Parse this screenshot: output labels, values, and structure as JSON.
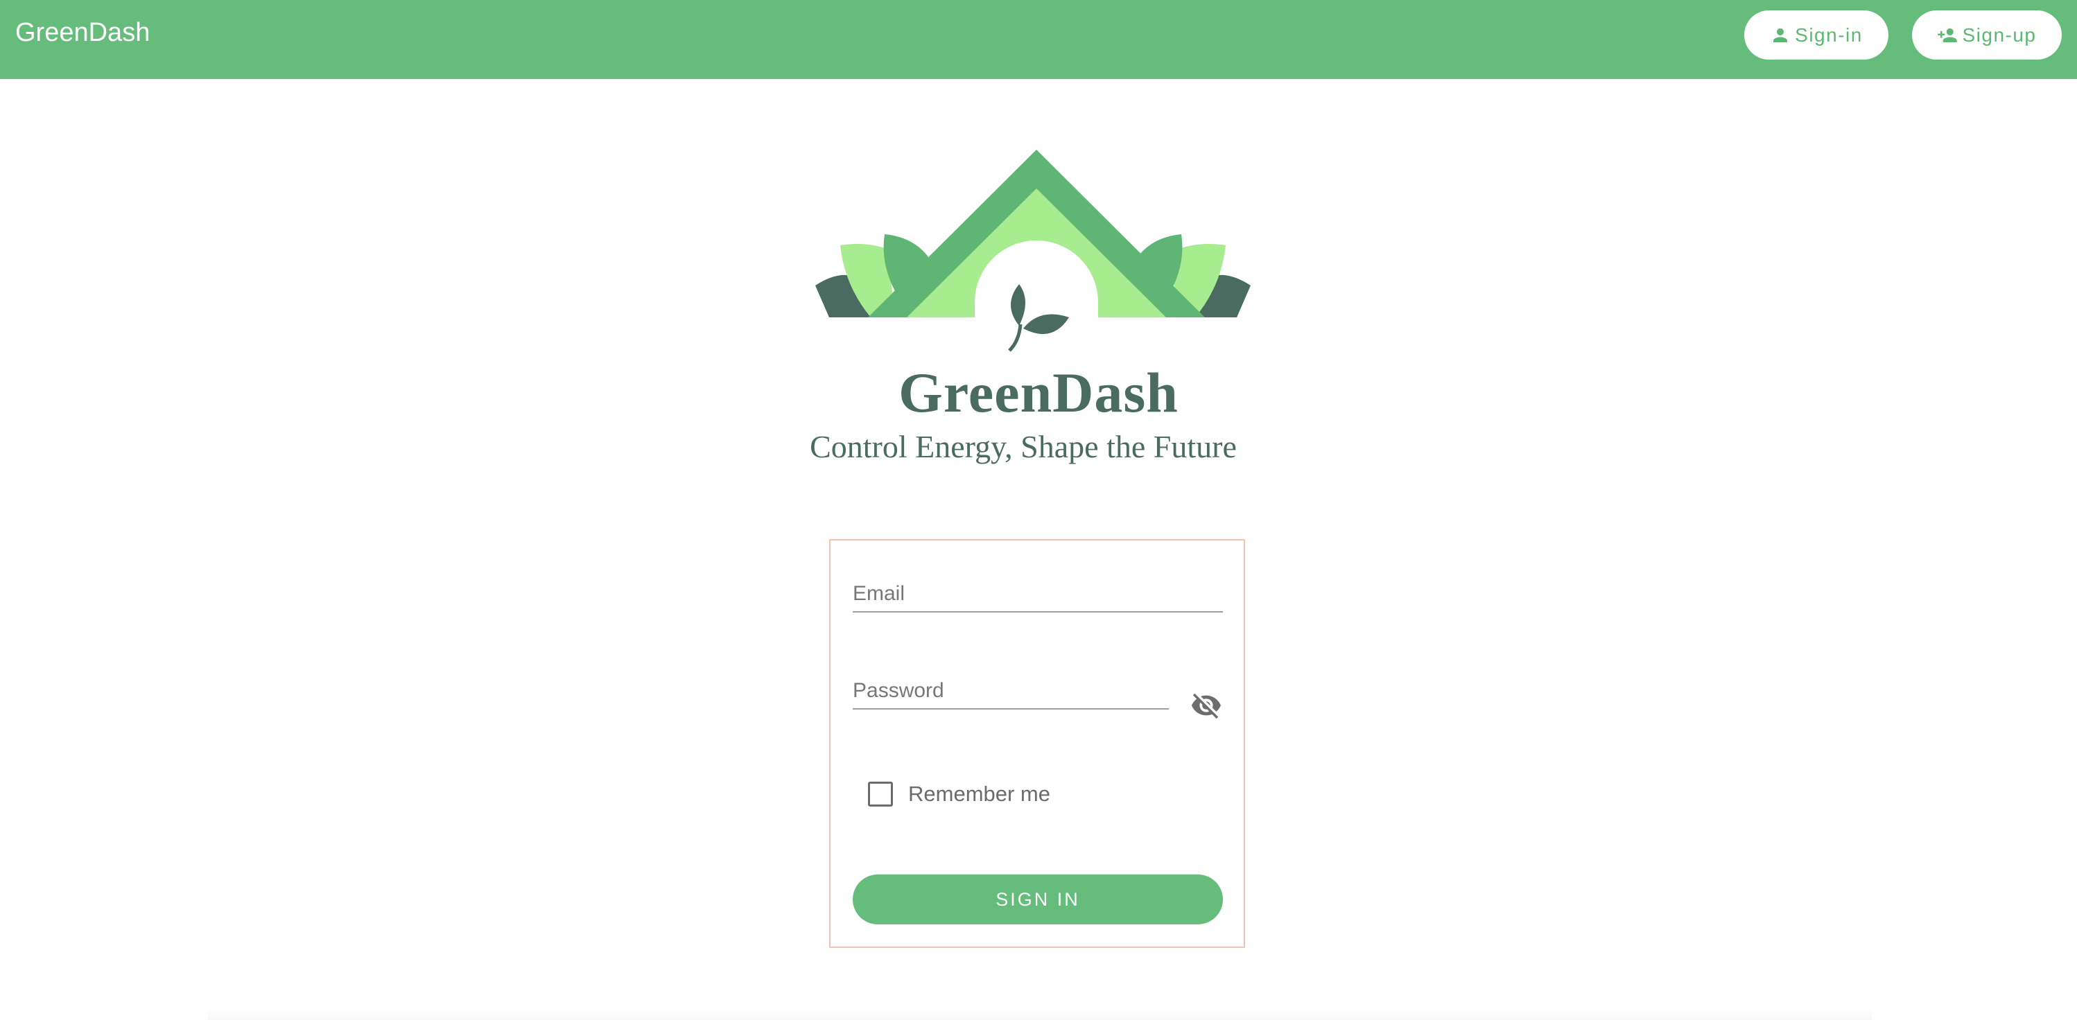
{
  "header": {
    "app_title": "GreenDash",
    "signin_label": "Sign-in",
    "signup_label": "Sign-up",
    "signin_icon": "person-icon",
    "signup_icon": "person-add-icon"
  },
  "brand": {
    "name": "GreenDash",
    "tagline": "Control Energy, Shape the Future"
  },
  "login_form": {
    "email_placeholder": "Email",
    "email_value": "",
    "password_placeholder": "Password",
    "password_value": "",
    "visibility_icon": "eye-off-icon",
    "remember_label": "Remember me",
    "remember_checked": false,
    "submit_label": "SIGN IN"
  },
  "colors": {
    "primary": "#66bd7b",
    "brand_dark": "#4a6b60",
    "leaf_light": "#a8ec90",
    "card_border": "#f4c1b4"
  }
}
